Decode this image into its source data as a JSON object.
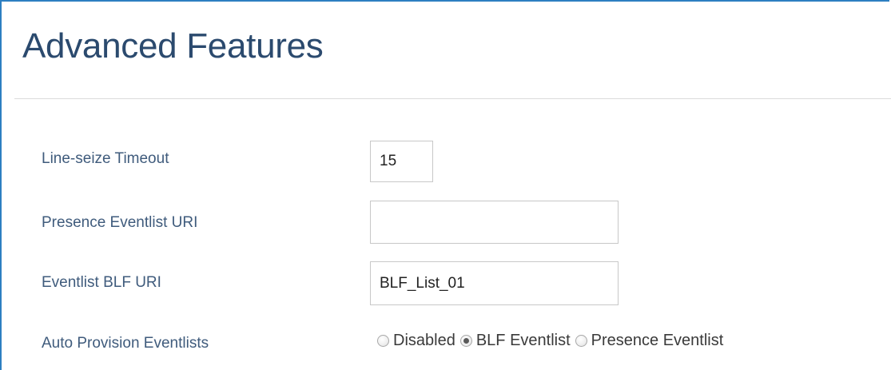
{
  "section": {
    "title": "Advanced Features"
  },
  "fields": {
    "line_seize_timeout": {
      "label": "Line-seize Timeout",
      "value": "15",
      "placeholder": ""
    },
    "presence_eventlist_uri": {
      "label": "Presence Eventlist URI",
      "value": "",
      "placeholder": ""
    },
    "eventlist_blf_uri": {
      "label": "Eventlist BLF URI",
      "value": "BLF_List_01",
      "placeholder": ""
    },
    "auto_provision_eventlists": {
      "label": "Auto Provision Eventlists",
      "selected": "BLF Eventlist",
      "options": [
        {
          "label": "Disabled",
          "checked": false
        },
        {
          "label": "BLF Eventlist",
          "checked": true
        },
        {
          "label": "Presence Eventlist",
          "checked": false
        }
      ]
    }
  },
  "colors": {
    "title": "#2b4a6e",
    "label": "#3f5b7c",
    "frame_border": "#2d7fc1",
    "input_border": "#c8c8c8",
    "divider": "#dcdcdc"
  }
}
